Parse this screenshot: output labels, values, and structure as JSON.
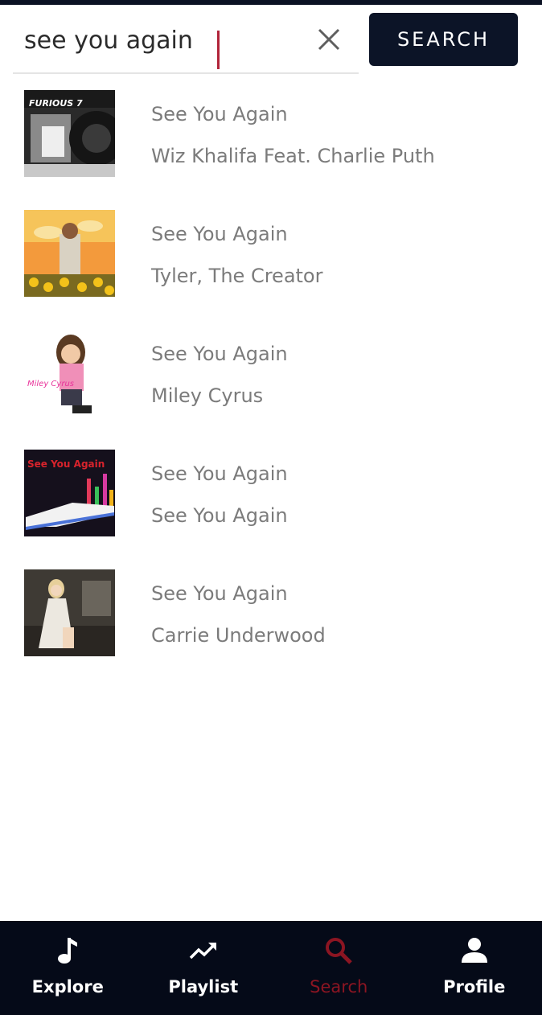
{
  "search": {
    "query": "see you again",
    "button_label": "SEARCH"
  },
  "results": [
    {
      "title": "See You Again",
      "artist": "Wiz Khalifa Feat. Charlie Puth",
      "art_text": "FURIOUS 7"
    },
    {
      "title": "See You Again",
      "artist": "Tyler, The Creator",
      "art_text": ""
    },
    {
      "title": "See You Again",
      "artist": "Miley Cyrus",
      "art_text": "Miley Cyrus"
    },
    {
      "title": "See You Again",
      "artist": "See You Again",
      "art_text": "See You Again"
    },
    {
      "title": "See You Again",
      "artist": "Carrie Underwood",
      "art_text": ""
    }
  ],
  "nav": {
    "explore": "Explore",
    "playlist": "Playlist",
    "search": "Search",
    "profile": "Profile",
    "active": "search"
  },
  "colors": {
    "nav_background": "#050a18",
    "button_background": "#0c1427",
    "active_tab": "#8c1522",
    "caret": "#b1243a",
    "text_secondary": "#7b7b7b"
  }
}
